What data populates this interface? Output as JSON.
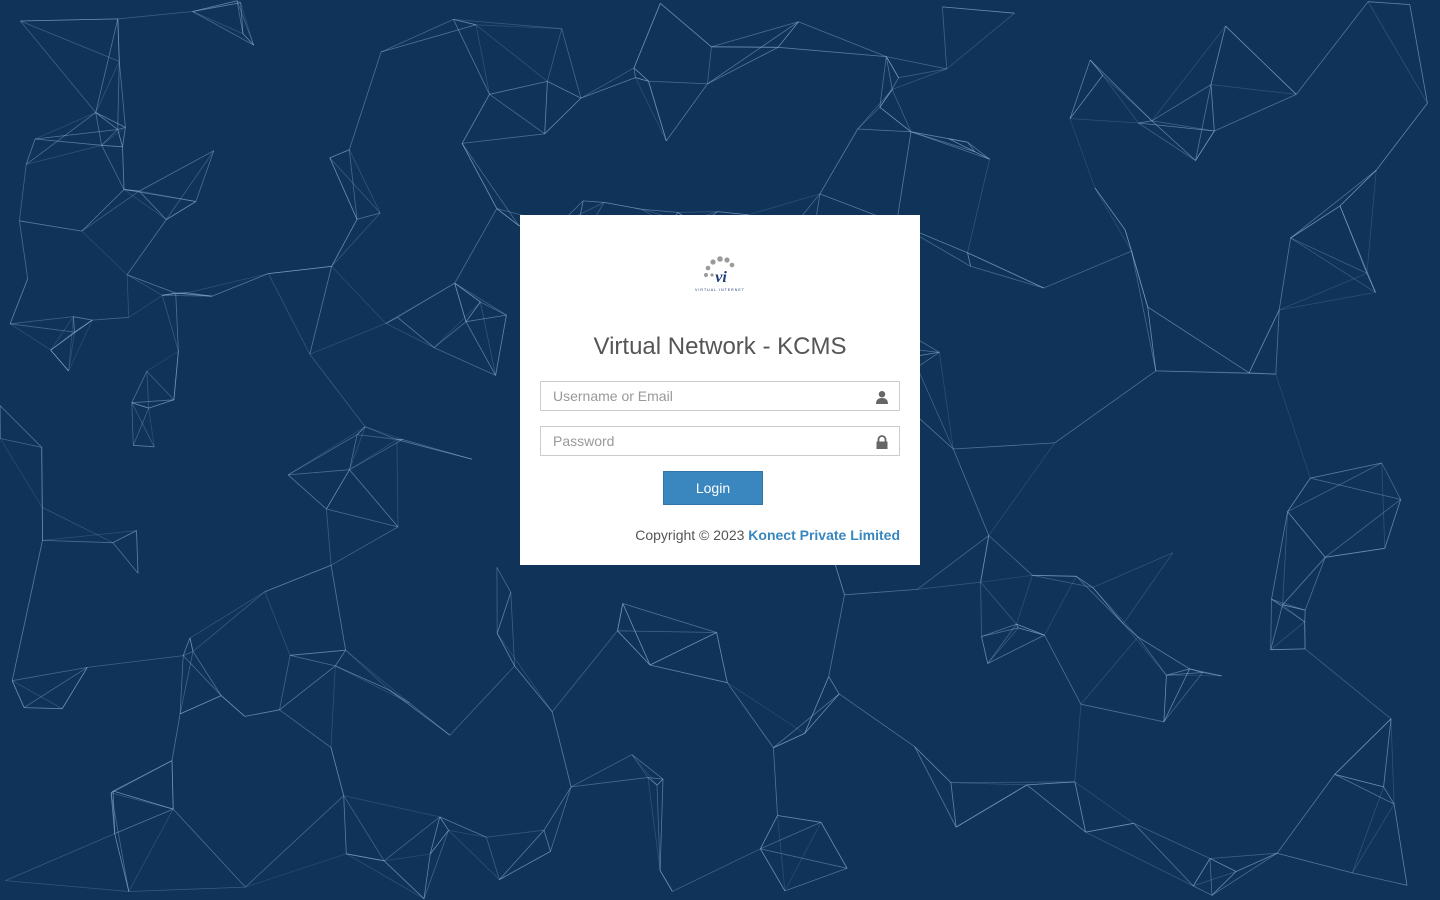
{
  "colors": {
    "background": "#0f3359",
    "network_lines": "#8fb4d6",
    "card": "#ffffff",
    "button": "#3a87c0",
    "link": "#3a87c0",
    "logo_dots": "#9a9a9a",
    "logo_mark": "#1f3a7a"
  },
  "logo": {
    "mark_text": "vi",
    "tagline": "VIRTUAL INTERNET"
  },
  "login": {
    "title": "Virtual Network - KCMS",
    "username_placeholder": "Username or Email",
    "password_placeholder": "Password",
    "username_icon": "user-icon",
    "password_icon": "lock-icon",
    "button_label": "Login"
  },
  "footer": {
    "copyright_prefix": "Copyright © 2023",
    "company_name": "Konect Private Limited"
  }
}
